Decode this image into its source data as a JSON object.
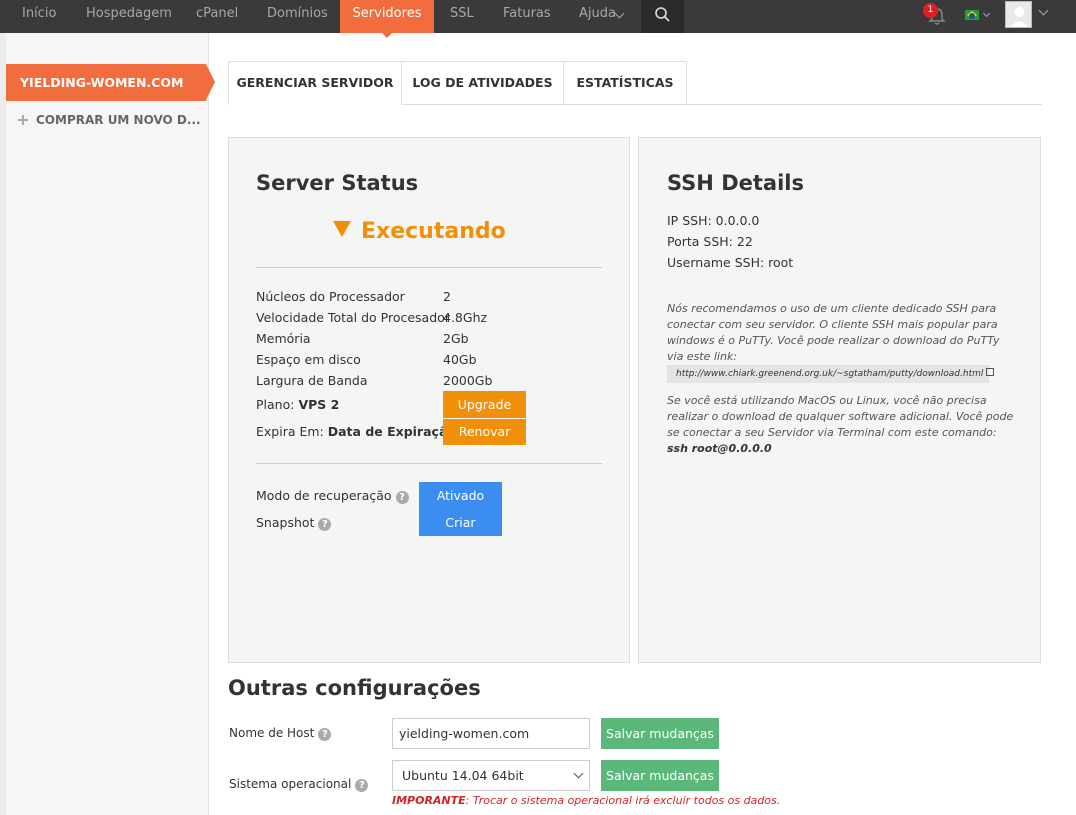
{
  "nav": {
    "items": [
      "Início",
      "Hospedagem",
      "cPanel",
      "Domínios",
      "Servidores",
      "SSL",
      "Faturas",
      "Ajuda"
    ],
    "active": "Servidores",
    "notification_count": "1"
  },
  "sidebar": {
    "active_item": "YIELDING-WOMEN.COM",
    "buy_item": "COMPRAR UM NOVO D..."
  },
  "tabs": [
    "GERENCIAR SERVIDOR",
    "LOG DE ATIVIDADES",
    "ESTATÍSTICAS"
  ],
  "server_status": {
    "title": "Server Status",
    "status": "Executando",
    "specs": [
      {
        "label": "Núcleos do Processador",
        "value": "2"
      },
      {
        "label": "Velocidade Total do Procesador",
        "value": "4.8Ghz"
      },
      {
        "label": "Memória",
        "value": "2Gb"
      },
      {
        "label": "Espaço em disco",
        "value": "40Gb"
      },
      {
        "label": "Largura de Banda",
        "value": "2000Gb"
      }
    ],
    "plan_label": "Plano:",
    "plan_value": "VPS 2",
    "upgrade_button": "Upgrade",
    "expires_label": "Expira Em:",
    "expires_value": "Data de Expiração",
    "renew_button": "Renovar",
    "recovery_label": "Modo de recuperação",
    "recovery_button": "Ativado",
    "snapshot_label": "Snapshot",
    "snapshot_button": "Criar"
  },
  "ssh": {
    "title": "SSH Details",
    "ip": "IP SSH: 0.0.0.0",
    "port": "Porta SSH: 22",
    "username": "Username SSH: root",
    "note1": "Nós recomendamos o uso de um cliente dedicado SSH para conectar com seu servidor. O cliente SSH mais popular para windows é o PuTTy. Você pode realizar o download do PuTTy via este link:",
    "link": "http://www.chiark.greenend.org.uk/~sgtatham/putty/download.html",
    "note2": "Se você está utilizando MacOS ou Linux, você não precisa realizar o download de qualquer software adicional. Você pode se conectar a seu Servidor via Terminal com este comando:",
    "command": "ssh root@0.0.0.0"
  },
  "other": {
    "title": "Outras configurações",
    "hostname_label": "Nome de Host",
    "hostname_value": "yielding-women.com",
    "save_button": "Salvar mudanças",
    "os_label": "Sistema operacional",
    "os_value": "Ubuntu 14.04 64bit",
    "warning_prefix": "IMPORANTE",
    "warning_text": ": Trocar o sistema operacional irá excluir todos os dados."
  },
  "colors": {
    "accent": "#f26d3d",
    "orange": "#f0900a",
    "blue": "#3b8ef0",
    "green": "#5cb87a",
    "nav_bg": "#3a3a3a"
  }
}
